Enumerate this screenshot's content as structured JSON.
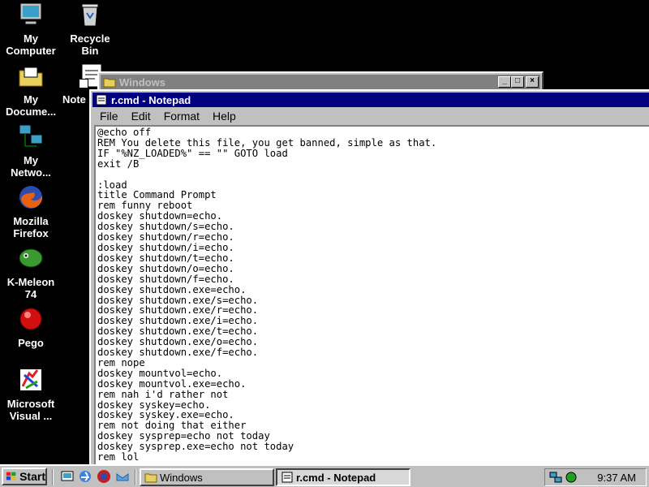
{
  "desktop": {
    "icons": [
      {
        "label": "My\nComputer",
        "icon": "my-computer-icon"
      },
      {
        "label": "Recycle\nBin",
        "icon": "recycle-bin-icon"
      },
      {
        "label": "My\nDocume...",
        "icon": "my-documents-icon"
      },
      {
        "label": "Note",
        "icon": "notepad-icon"
      },
      {
        "label": "My\nNetwo...",
        "icon": "network-icon"
      },
      {
        "label": "Mozilla\nFirefox",
        "icon": "firefox-icon"
      },
      {
        "label": "K-Meleon\n74",
        "icon": "k-meleon-icon"
      },
      {
        "label": "Pego",
        "icon": "pego-icon"
      },
      {
        "label": "Microsoft\nVisual ...",
        "icon": "visual-studio-icon"
      }
    ]
  },
  "explorer_window": {
    "title": "Windows",
    "buttons": {
      "minimize": "_",
      "maximize": "□",
      "close": "×"
    }
  },
  "notepad": {
    "title": "r.cmd - Notepad",
    "menu": [
      "File",
      "Edit",
      "Format",
      "Help"
    ],
    "content": "@echo off\nREM You delete this file, you get banned, simple as that.\nIF \"%NZ_LOADED%\" == \"\" GOTO load\nexit /B\n\n:load\ntitle Command Prompt\nrem funny reboot\ndoskey shutdown=echo.\ndoskey shutdown/s=echo.\ndoskey shutdown/r=echo.\ndoskey shutdown/i=echo.\ndoskey shutdown/t=echo.\ndoskey shutdown/o=echo.\ndoskey shutdown/f=echo.\ndoskey shutdown.exe=echo.\ndoskey shutdown.exe/s=echo.\ndoskey shutdown.exe/r=echo.\ndoskey shutdown.exe/i=echo.\ndoskey shutdown.exe/t=echo.\ndoskey shutdown.exe/o=echo.\ndoskey shutdown.exe/f=echo.\nrem nope\ndoskey mountvol=echo.\ndoskey mountvol.exe=echo.\nrem nah i'd rather not\ndoskey syskey=echo.\ndoskey syskey.exe=echo.\nrem not doing that either\ndoskey sysprep=echo not today\ndoskey sysprep.exe=echo not today\nrem lol"
  },
  "taskbar": {
    "start_label": "Start",
    "quick_launch": [
      "show-desktop-icon",
      "internet-explorer-icon",
      "firefox-icon",
      "outlook-icon"
    ],
    "tasks": [
      {
        "label": "Windows",
        "pressed": false
      },
      {
        "label": "r.cmd - Notepad",
        "pressed": true
      }
    ],
    "clock": "9:37 AM"
  },
  "colors": {
    "desktop": "#000000",
    "titlebar_active": "#000080",
    "titlebar_inactive": "#808080",
    "face": "#c0c0c0"
  }
}
